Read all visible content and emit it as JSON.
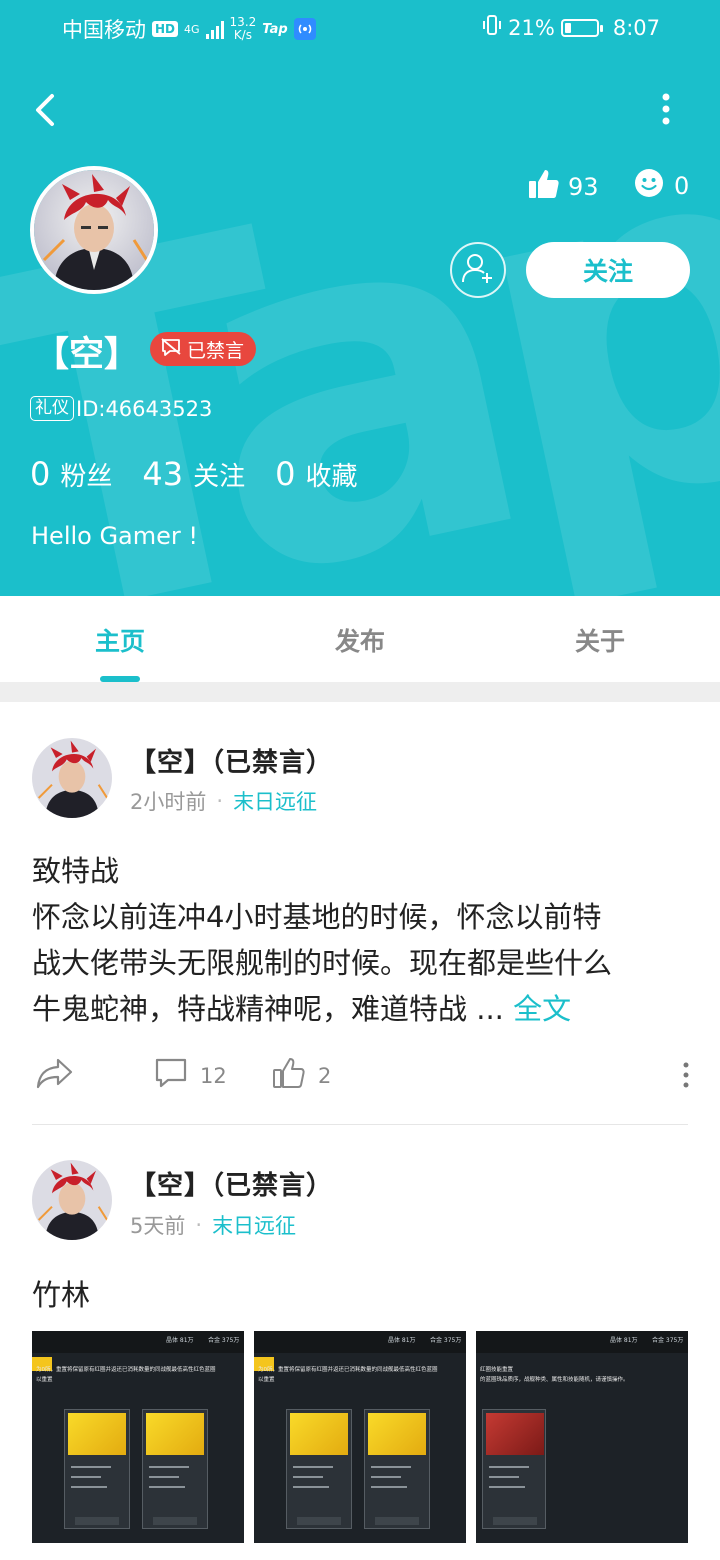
{
  "status_bar": {
    "carrier": "中国移动",
    "hd": "HD",
    "network": "4G",
    "speed_value": "13.2",
    "speed_unit": "K/s",
    "tap_label": "Tap",
    "battery": "21%",
    "battery_level": 0.21,
    "time": "8:07"
  },
  "profile": {
    "name": "【空】",
    "banned_label": "已禁言",
    "etiquette_tag": "礼仪",
    "id_text": "ID:46643523",
    "likes": "93",
    "smiles": "0",
    "follow_label": "关注",
    "stats": [
      {
        "num": "0",
        "label": "粉丝"
      },
      {
        "num": "43",
        "label": "关注"
      },
      {
        "num": "0",
        "label": "收藏"
      }
    ],
    "bio": "Hello Gamer !"
  },
  "watermark": "TapTap",
  "tabs": [
    {
      "label": "主页",
      "active": true
    },
    {
      "label": "发布",
      "active": false
    },
    {
      "label": "关于",
      "active": false
    }
  ],
  "posts": [
    {
      "author": "【空】（已禁言）",
      "time": "2小时前",
      "dot": "·",
      "game": "末日远征",
      "title": "致特战",
      "body_lines": [
        "怀念以前连冲4小时基地的时候，怀念以前特",
        "战大佬带头无限舰制的时候。现在都是些什么",
        "牛鬼蛇神，特战精神呢，难道特战"
      ],
      "ellipsis": " ... ",
      "full_text_label": "全文",
      "comments": "12",
      "likes": "2"
    },
    {
      "author": "【空】（已禁言）",
      "time": "5天前",
      "dot": "·",
      "game": "末日远征",
      "title": "竹林",
      "thumbnails": [
        {
          "res1": "晶体 81万",
          "res2": "合金 375万",
          "desc1": "为0所，重置将保留原有红圈并返还已消耗数量的同战舰最低高性红色蓝圈",
          "desc2": "以重置"
        },
        {
          "res1": "晶体 81万",
          "res2": "合金 375万",
          "desc1": "为0所，重置将保留原有红圈并返还已消耗数量的同战舰最低高性红色蓝圈",
          "desc2": "以重置"
        },
        {
          "res1": "晶体 81万",
          "res2": "合金 375万",
          "desc1": "红圈技能重置",
          "desc2": "的蓝圈珠品质序，战舰种类、属性和技能随机，请谨慎操作。"
        }
      ]
    }
  ]
}
